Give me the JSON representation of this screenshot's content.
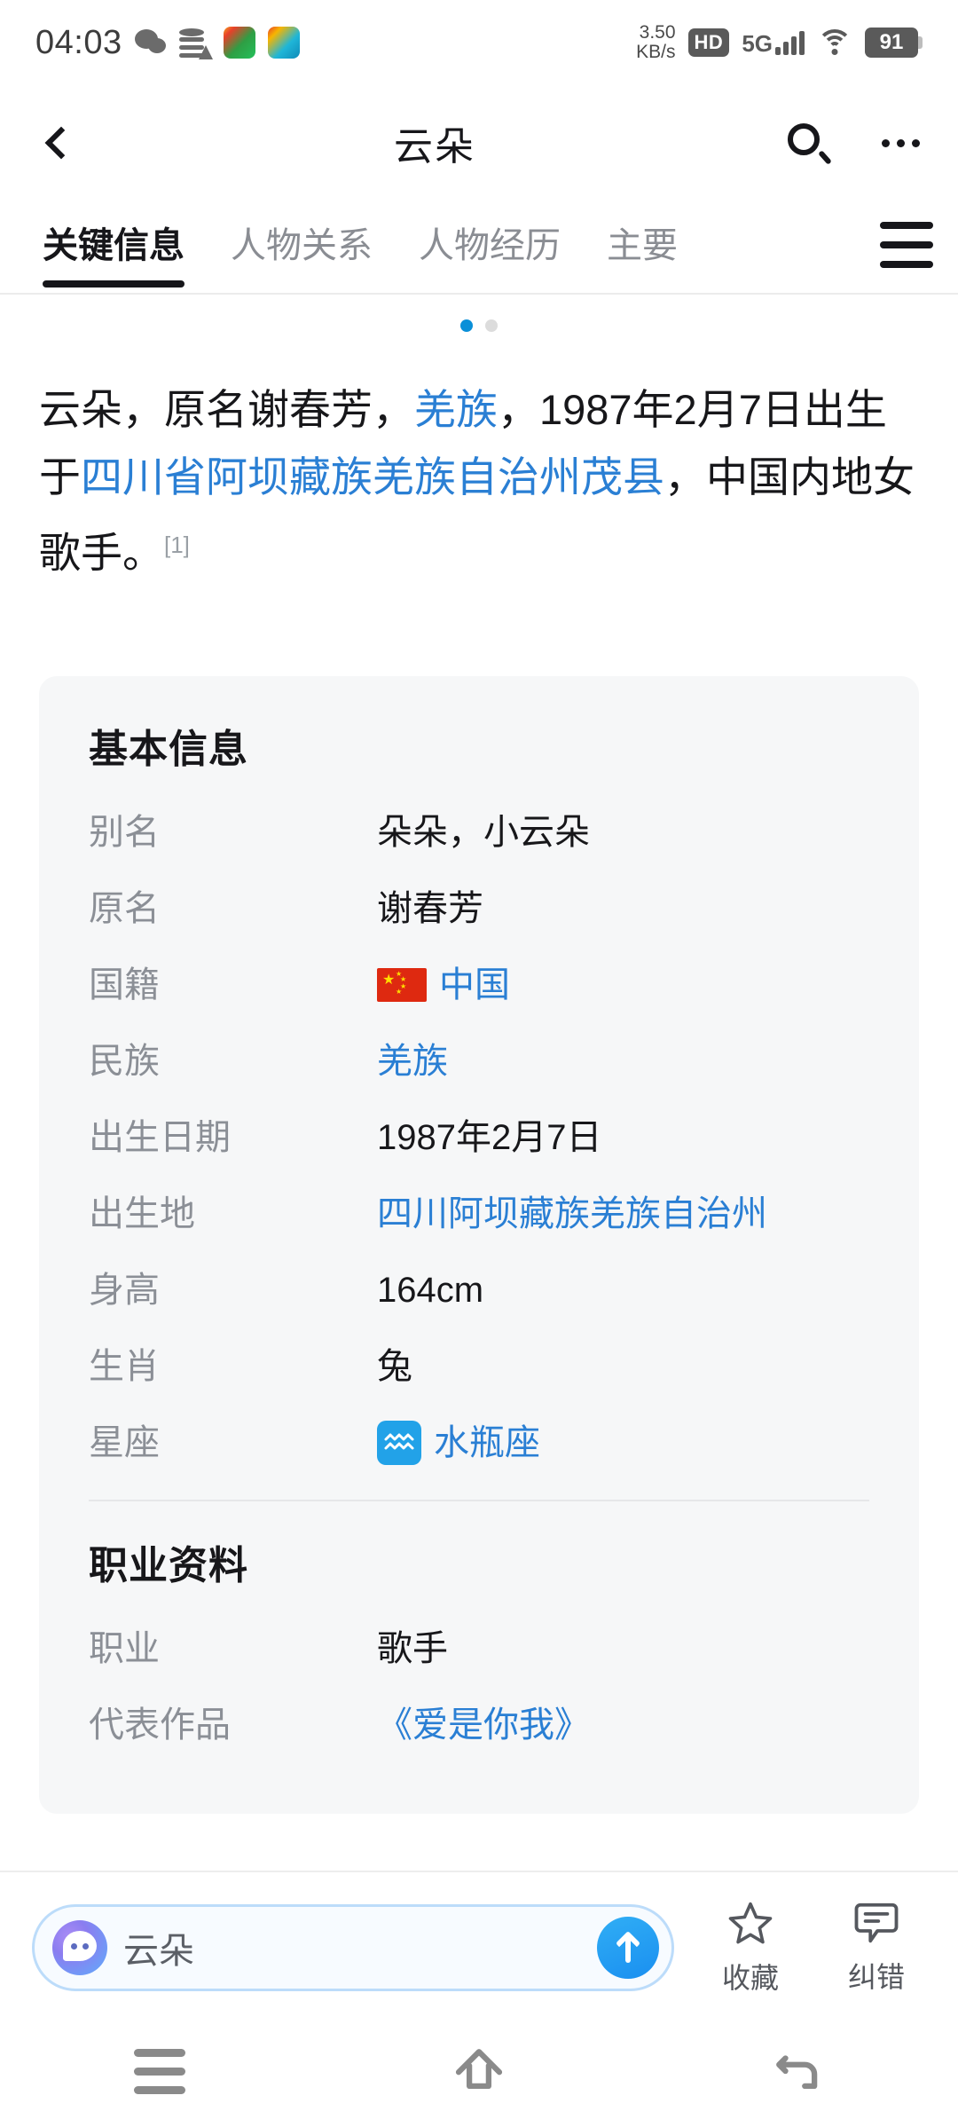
{
  "statusbar": {
    "clock": "04:03",
    "icons": [
      "wechat-icon",
      "data-saver-icon",
      "game-app-1-icon",
      "game-app-2-icon"
    ],
    "network_speed_value": "3.50",
    "network_speed_unit": "KB/s",
    "hd": "HD",
    "network_type": "5G",
    "signal_bars": 4,
    "wifi": "wifi-icon",
    "battery_percent": "91"
  },
  "header": {
    "back": "back-icon",
    "title": "云朵",
    "search": "search-icon",
    "more": "more-icon"
  },
  "tabs": {
    "items": [
      {
        "label": "关键信息",
        "active": true
      },
      {
        "label": "人物关系",
        "active": false
      },
      {
        "label": "人物经历",
        "active": false
      },
      {
        "label": "主要",
        "active": false
      }
    ],
    "menu_icon": "hamburger-menu-icon"
  },
  "pager": {
    "total": 2,
    "active_index": 0
  },
  "intro": {
    "seg1": "云朵，原名谢春芳，",
    "link1": "羌族",
    "seg2": "，1987年2月7日出生于",
    "link2": "四川省阿坝藏族羌族自治州茂县",
    "seg3": "，中国内地女歌手。",
    "ref": "[1]"
  },
  "info_card": {
    "basic_title": "基本信息",
    "basic_rows": [
      {
        "label": "别名",
        "value": "朵朵，小云朵",
        "link": false
      },
      {
        "label": "原名",
        "value": "谢春芳",
        "link": false
      },
      {
        "label": "国籍",
        "value": "中国",
        "link": true,
        "icon": "china-flag-icon"
      },
      {
        "label": "民族",
        "value": "羌族",
        "link": true
      },
      {
        "label": "出生日期",
        "value": "1987年2月7日",
        "link": false
      },
      {
        "label": "出生地",
        "value": "四川阿坝藏族羌族自治州",
        "link": true
      },
      {
        "label": "身高",
        "value": "164cm",
        "link": false
      },
      {
        "label": "生肖",
        "value": "兔",
        "link": false
      },
      {
        "label": "星座",
        "value": "水瓶座",
        "link": true,
        "icon": "aquarius-icon"
      }
    ],
    "career_title": "职业资料",
    "career_rows": [
      {
        "label": "职业",
        "value": "歌手",
        "link": false
      },
      {
        "label": "代表作品",
        "value": "《爱是你我》",
        "link": true
      }
    ]
  },
  "bottombar": {
    "search_value": "云朵",
    "avatar": "chat-assistant-avatar-icon",
    "submit": "submit-arrow-icon",
    "favorite_label": "收藏",
    "favorite_icon": "star-icon",
    "report_label": "纠错",
    "report_icon": "comment-icon"
  },
  "navbar": {
    "recents": "recents-icon",
    "home": "home-icon",
    "back": "back-nav-icon"
  },
  "colors": {
    "link_blue": "#2a7fd4",
    "accent_blue": "#1a8ff0",
    "text_primary": "#17171a",
    "text_secondary": "#8b8f96",
    "card_bg": "#f6f7f8"
  }
}
